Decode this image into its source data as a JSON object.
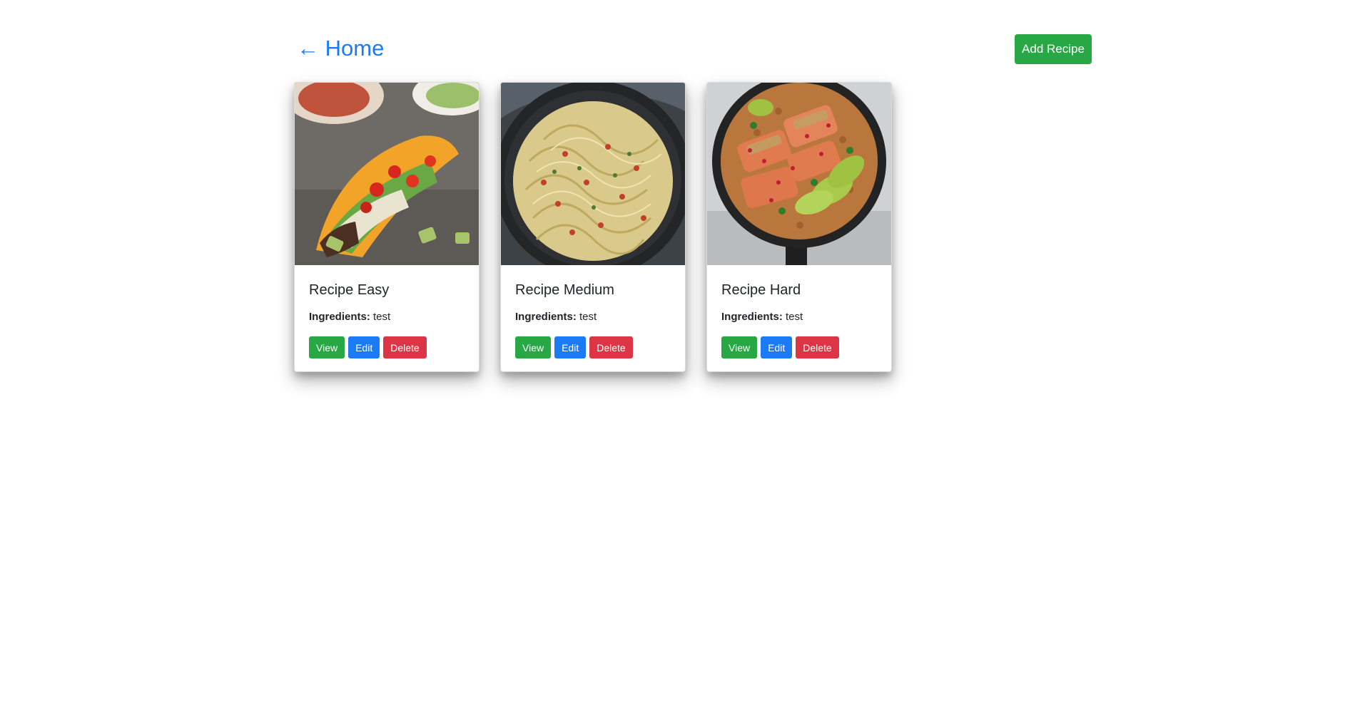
{
  "nav": {
    "home_label": "← Home"
  },
  "toolbar": {
    "add_label": "Add Recipe"
  },
  "colors": {
    "primary": "#1a7bf5",
    "success": "#28a745",
    "danger": "#dc3545",
    "text": "#212529"
  },
  "recipes": [
    {
      "title": "Recipe Easy",
      "ingredients_label": "Ingredients:",
      "ingredients_value": "test",
      "view_label": "View",
      "edit_label": "Edit",
      "delete_label": "Delete",
      "image": "taco-photo"
    },
    {
      "title": "Recipe Medium",
      "ingredients_label": "Ingredients:",
      "ingredients_value": "test",
      "view_label": "View",
      "edit_label": "Edit",
      "delete_label": "Delete",
      "image": "pasta-pan-photo"
    },
    {
      "title": "Recipe Hard",
      "ingredients_label": "Ingredients:",
      "ingredients_value": "test",
      "view_label": "View",
      "edit_label": "Edit",
      "delete_label": "Delete",
      "image": "salmon-skillet-photo"
    }
  ]
}
